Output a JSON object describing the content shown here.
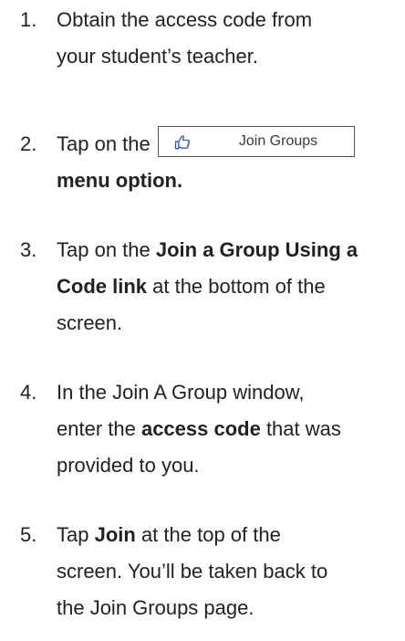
{
  "steps": [
    {
      "number": "1.",
      "line1": "Obtain the access code from",
      "line2": "your student’s teacher."
    },
    {
      "number": "2.",
      "prefix": "Tap on the",
      "button_label": "Join Groups",
      "button_icon": "pointing-hand-icon",
      "suffix_bold": "menu option."
    },
    {
      "number": "3.",
      "l1_text": "Tap on the ",
      "l1_bold": "Join a Group Using a",
      "l2_bold": "Code link",
      "l2_text": " at the bottom of the",
      "l3_text": "screen."
    },
    {
      "number": "4.",
      "l1_text": "In the Join A Group window,",
      "l2_text": "enter the ",
      "l2_bold": "access code",
      "l2_text_after": " that was",
      "l3_text": "provided to you."
    },
    {
      "number": "5.",
      "l1_text": "Tap ",
      "l1_bold": "Join",
      "l1_text_after": " at the top of the",
      "l2_text": "screen. You’ll be taken back to",
      "l3_text": "the Join Groups page."
    }
  ]
}
